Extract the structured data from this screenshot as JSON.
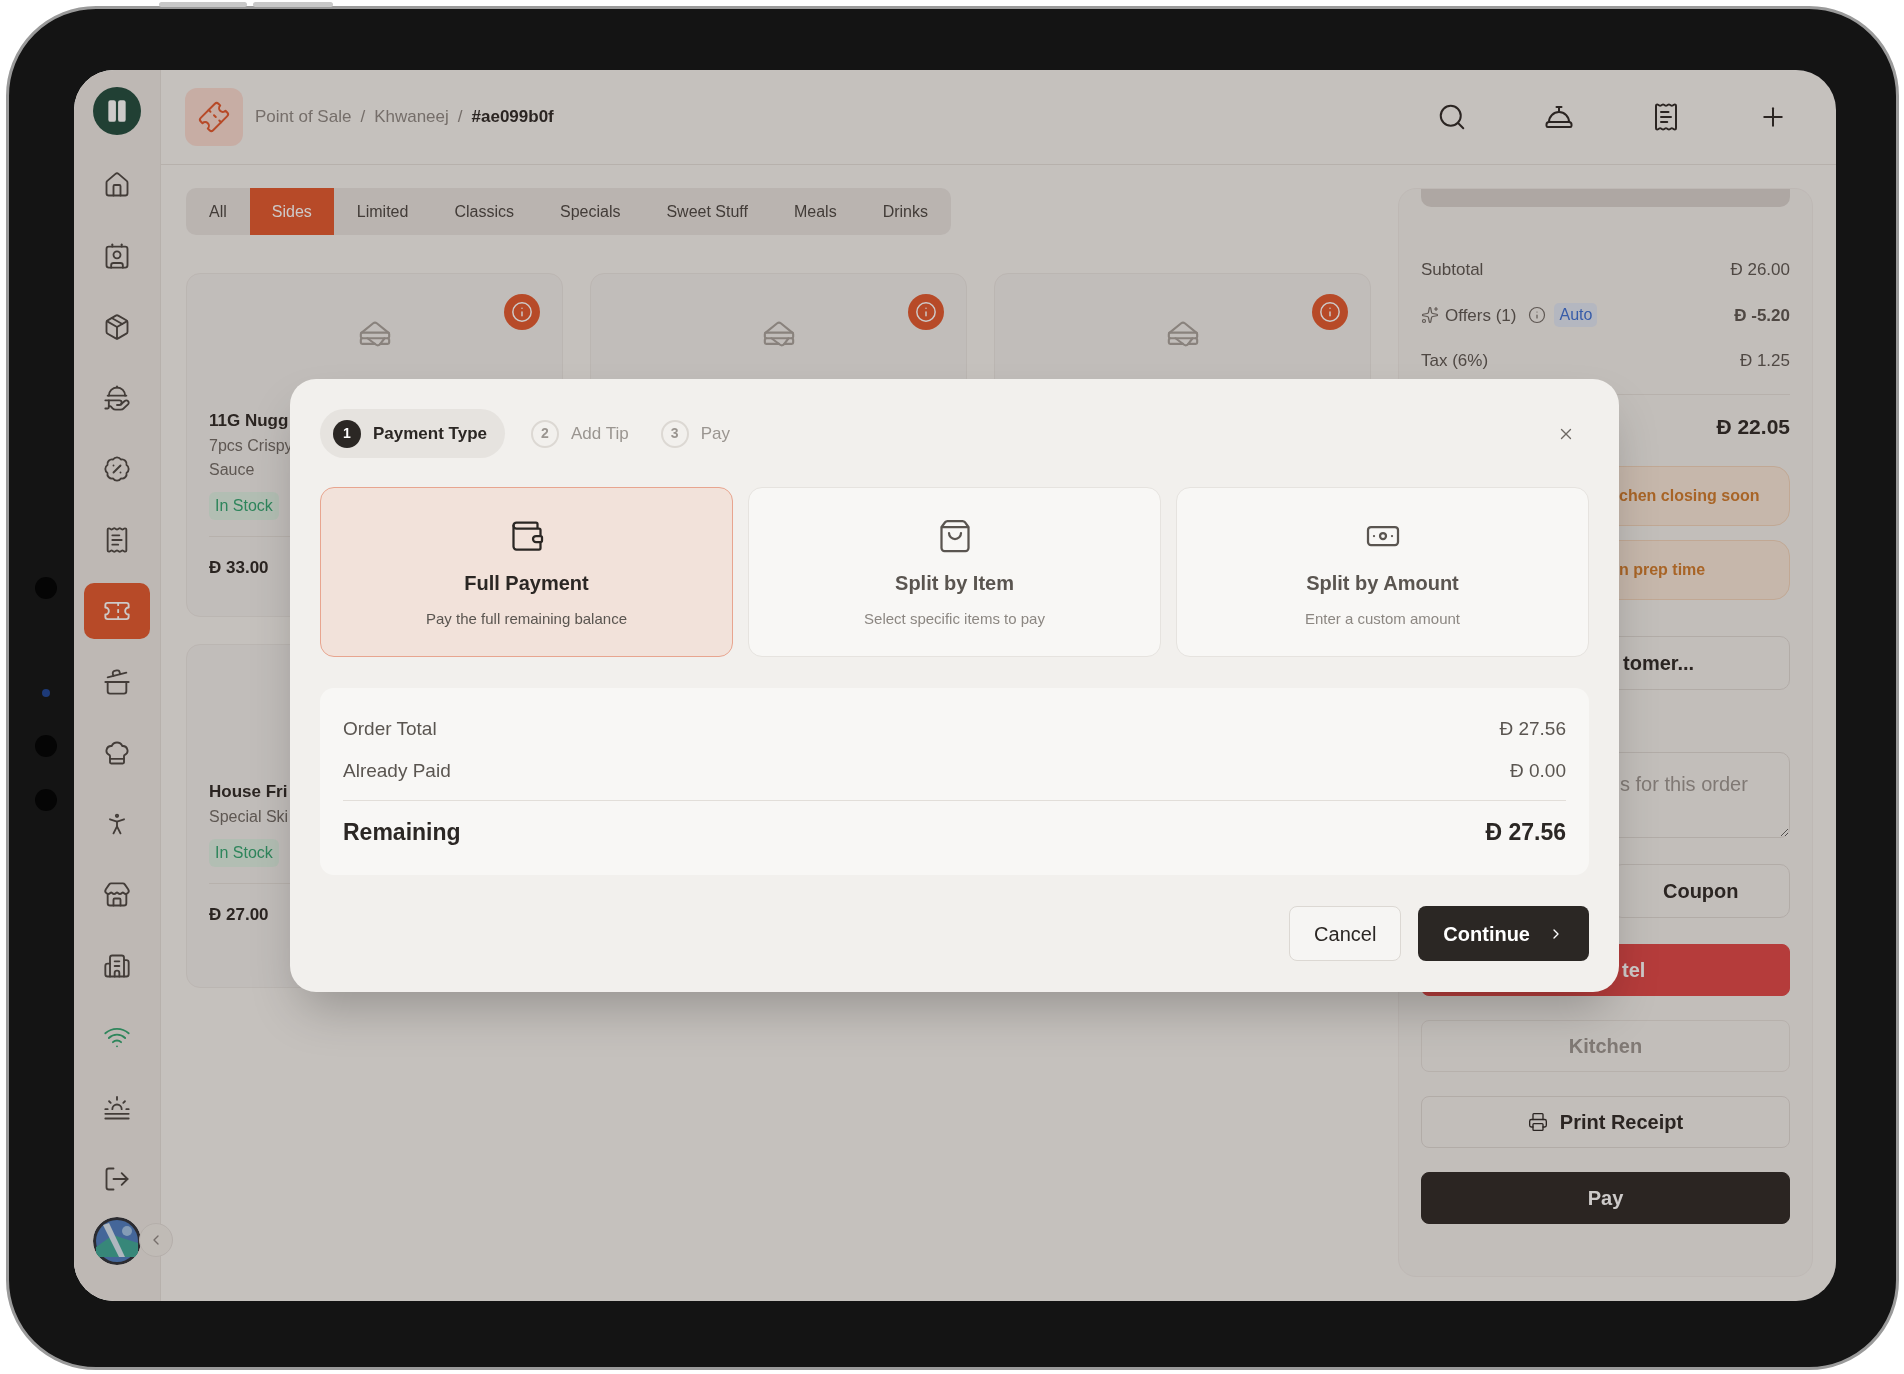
{
  "sidebar": {
    "items": [
      {
        "kind": "nav",
        "selected": false
      },
      {
        "kind": "nav",
        "selected": false
      },
      {
        "kind": "nav",
        "selected": false
      },
      {
        "kind": "nav",
        "selected": false
      },
      {
        "kind": "nav",
        "selected": false
      },
      {
        "kind": "nav",
        "selected": false
      },
      {
        "kind": "nav",
        "selected": true
      },
      {
        "kind": "nav",
        "selected": false
      },
      {
        "kind": "nav",
        "selected": false
      },
      {
        "kind": "nav",
        "selected": false
      },
      {
        "kind": "nav",
        "selected": false
      },
      {
        "kind": "nav",
        "selected": false
      },
      {
        "kind": "status",
        "on": true
      },
      {
        "kind": "nav",
        "selected": false
      },
      {
        "kind": "nav",
        "selected": false
      }
    ]
  },
  "header": {
    "breadcrumb": [
      "Point of Sale",
      "Khwaneej",
      "#ae099b0f"
    ],
    "separator": "/"
  },
  "categories": [
    {
      "label": "All",
      "selected": false
    },
    {
      "label": "Sides",
      "selected": true
    },
    {
      "label": "Limited",
      "selected": false
    },
    {
      "label": "Classics",
      "selected": false
    },
    {
      "label": "Specials",
      "selected": false
    },
    {
      "label": "Sweet Stuff",
      "selected": false
    },
    {
      "label": "Meals",
      "selected": false
    },
    {
      "label": "Drinks",
      "selected": false
    }
  ],
  "products": [
    {
      "show_media": true,
      "name": "11G Nugg",
      "description": [
        "7pcs Crispy",
        "Sauce"
      ],
      "stock": "In Stock",
      "price": "Ð 33.00"
    },
    {
      "show_media": true
    },
    {
      "show_media": true
    },
    {
      "name": "House Fri",
      "description": [
        "Special Ski"
      ],
      "stock": "In Stock",
      "price": "Ð 27.00"
    }
  ],
  "order_panel": {
    "rows": [
      {
        "kind": "plain",
        "label": "Subtotal",
        "value": "Ð 26.00"
      },
      {
        "kind": "offer",
        "label": "Offers (1)",
        "badge": "Auto",
        "value": "Ð -5.20"
      },
      {
        "kind": "plain",
        "label": "Tax (6%)",
        "value": "Ð 1.25"
      }
    ],
    "total": "Ð 22.05",
    "alerts": [
      "chen closing soon",
      "n prep time"
    ],
    "customer_button": "tomer...",
    "notes": {
      "placeholder": "s for this order"
    },
    "coupon_button": "Coupon",
    "buttons": [
      {
        "label": "tel",
        "kind": "danger"
      },
      {
        "label": "Kitchen",
        "kind": "disabled"
      },
      {
        "label": "Print Receipt",
        "kind": "print"
      },
      {
        "label": "Pay",
        "kind": "primary"
      }
    ]
  },
  "payment_dialog": {
    "steps": [
      {
        "number": "1",
        "label": "Payment Type",
        "selected": true
      },
      {
        "number": "2",
        "label": "Add Tip",
        "selected": false
      },
      {
        "number": "3",
        "label": "Pay",
        "selected": false
      }
    ],
    "options": [
      {
        "title": "Full Payment",
        "description": "Pay the full remaining balance",
        "selected": true
      },
      {
        "title": "Split by Item",
        "description": "Select specific items to pay",
        "selected": false
      },
      {
        "title": "Split by Amount",
        "description": "Enter a custom amount",
        "selected": false
      }
    ],
    "summary": {
      "rows": [
        {
          "label": "Order Total",
          "value": "Ð 27.56"
        },
        {
          "label": "Already Paid",
          "value": "Ð 0.00"
        }
      ],
      "remaining": {
        "label": "Remaining",
        "value": "Ð 27.56"
      }
    },
    "buttons": [
      {
        "label": "Cancel",
        "kind": "secondary"
      },
      {
        "label": "Continue",
        "kind": "primary"
      }
    ]
  }
}
